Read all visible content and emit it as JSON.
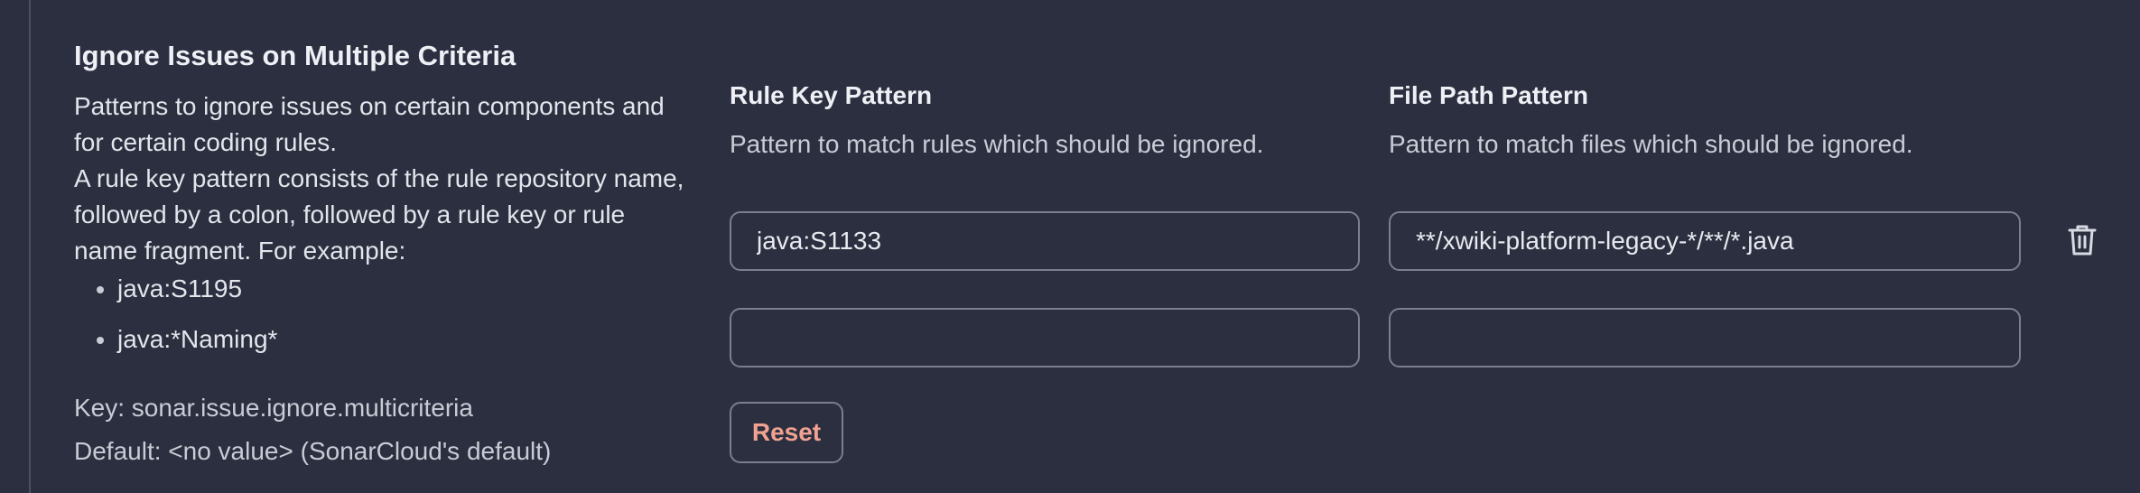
{
  "section": {
    "title": "Ignore Issues on Multiple Criteria",
    "description_1": "Patterns to ignore issues on certain components and for certain coding rules.",
    "description_2": "A rule key pattern consists of the rule repository name, followed by a colon, followed by a rule key or rule name fragment. For example:",
    "examples": [
      "java:S1195",
      "java:*Naming*"
    ],
    "key_line": "Key: sonar.issue.ignore.multicriteria",
    "default_line": "Default: <no value> (SonarCloud's default)"
  },
  "columns": {
    "rule_key": {
      "header": "Rule Key Pattern",
      "help": "Pattern to match rules which should be ignored."
    },
    "file_path": {
      "header": "File Path Pattern",
      "help": "Pattern to match files which should be ignored."
    }
  },
  "rows": [
    {
      "rule_key": "java:S1133",
      "file_path": "**/xwiki-platform-legacy-*/**/*.java"
    },
    {
      "rule_key": "",
      "file_path": ""
    }
  ],
  "actions": {
    "reset_label": "Reset",
    "delete_icon": "trash-icon"
  },
  "colors": {
    "background": "#2b2f3f",
    "border": "#7a7f90",
    "reset_text": "#f0a291"
  }
}
